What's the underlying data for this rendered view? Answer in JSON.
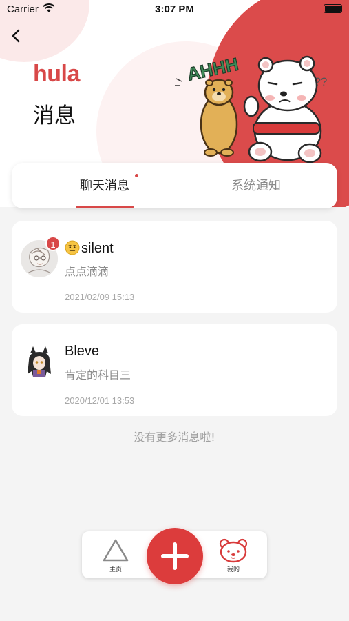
{
  "status_bar": {
    "carrier": "Carrier",
    "time": "3:07 PM"
  },
  "header": {
    "logo": "hula",
    "title": "消息",
    "sticker_text_1": "AHHH",
    "sticker_text_2": "???"
  },
  "tabs": [
    {
      "label": "聊天消息",
      "active": true,
      "has_dot": true
    },
    {
      "label": "系统通知",
      "active": false
    }
  ],
  "messages": [
    {
      "name": "silent",
      "text": "点点滴滴",
      "time": "2021/02/09 15:13",
      "unread": "1"
    },
    {
      "name": "Bleve",
      "text": "肯定的科目三",
      "time": "2020/12/01 13:53"
    }
  ],
  "empty_hint": "没有更多消息啦!",
  "bottom_nav": {
    "home": "主页",
    "mine": "我的"
  },
  "colors": {
    "accent": "#d84848",
    "background": "#f4f4f4"
  }
}
